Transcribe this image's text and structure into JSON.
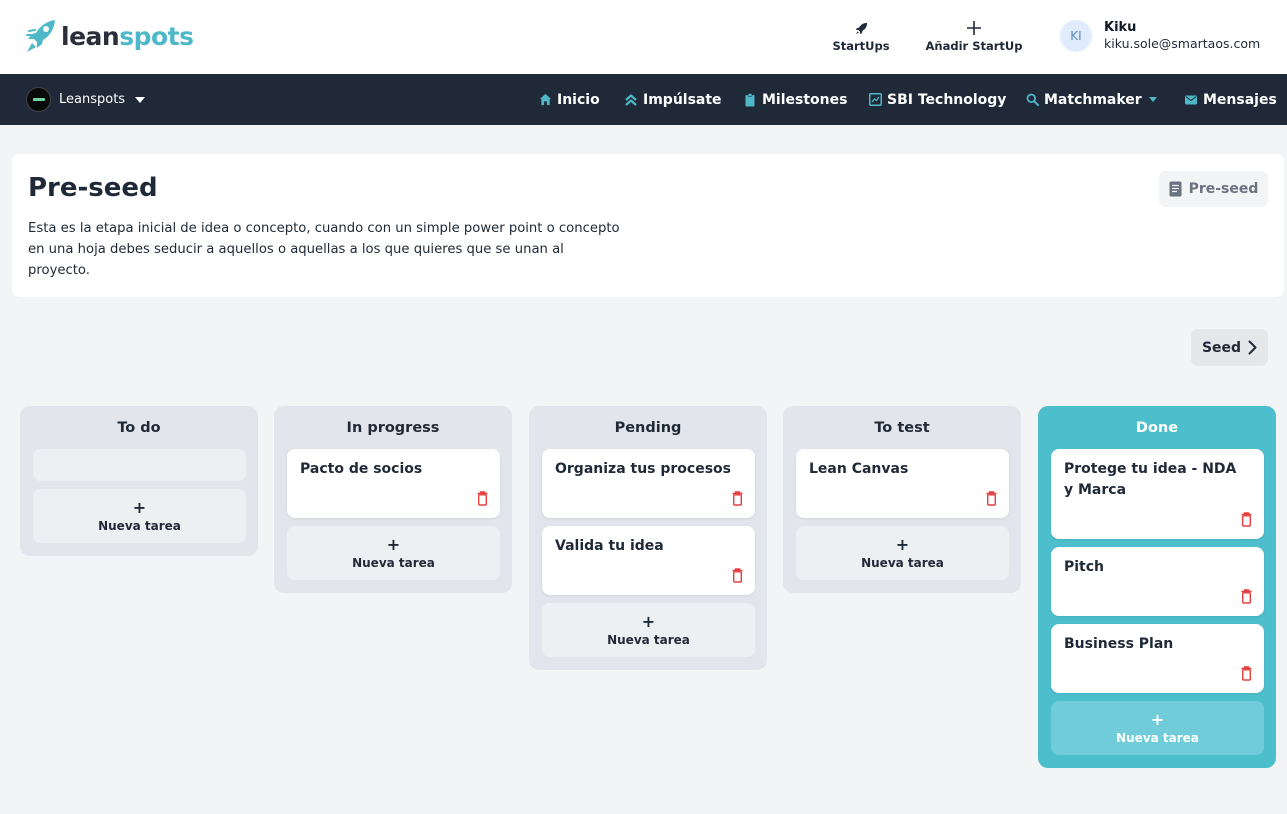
{
  "brand": {
    "logo_part1": "lean",
    "logo_part2": "spots"
  },
  "header": {
    "startups_label": "StartUps",
    "add_startup_label": "Añadir StartUp",
    "user": {
      "initials": "KI",
      "name": "Kiku",
      "email": "kiku.sole@smartaos.com"
    }
  },
  "nav": {
    "org_name": "Leanspots",
    "items": [
      {
        "label": "Inicio",
        "icon": "home-icon"
      },
      {
        "label": "Impúlsate",
        "icon": "chevrons-up-icon"
      },
      {
        "label": "Milestones",
        "icon": "clipboard-icon"
      },
      {
        "label": "SBI Technology",
        "icon": "chart-icon"
      },
      {
        "label": "Matchmaker",
        "icon": "search-icon"
      },
      {
        "label": "Mensajes",
        "icon": "mail-icon"
      }
    ]
  },
  "stage": {
    "title": "Pre-seed",
    "description": "Esta es la etapa inicial de idea o concepto, cuando con un simple power point o concepto en una hoja debes seducir a aquellos o aquellas a los que quieres que se unan al proyecto.",
    "badge": "Pre-seed",
    "next_label": "Seed"
  },
  "board": {
    "new_task_label": "Nueva tarea",
    "plus": "+",
    "columns": [
      {
        "title": "To do",
        "tasks": []
      },
      {
        "title": "In progress",
        "tasks": [
          "Pacto de socios"
        ]
      },
      {
        "title": "Pending",
        "tasks": [
          "Organiza tus procesos",
          "Valida tu idea"
        ]
      },
      {
        "title": "To test",
        "tasks": [
          "Lean Canvas"
        ]
      },
      {
        "title": "Done",
        "tasks": [
          "Protege tu idea - NDA y Marca",
          "Pitch",
          "Business Plan"
        ]
      }
    ]
  },
  "colors": {
    "accent": "#4fb8c8",
    "navbar": "#1f2937",
    "done_column": "#4dbfcc",
    "trash": "#e53e3e"
  }
}
